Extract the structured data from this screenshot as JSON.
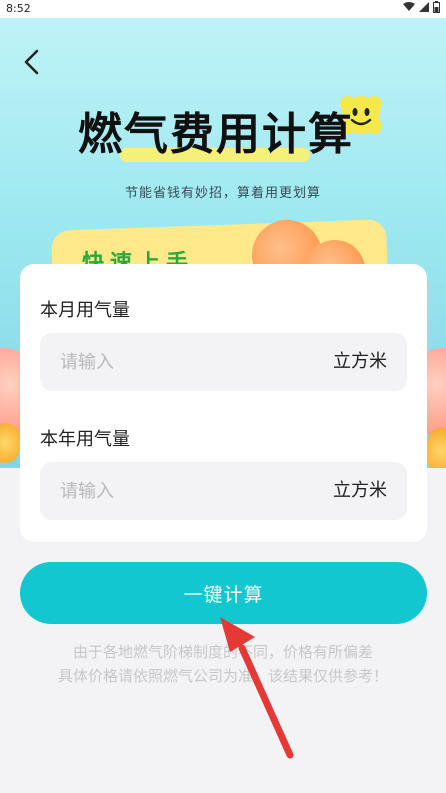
{
  "status_bar": {
    "time": "8:52",
    "icons": [
      "wifi-icon",
      "signal-icon",
      "battery-icon"
    ]
  },
  "header": {
    "back_icon": "chevron-left-icon",
    "title": "燃气费用计算",
    "subtitle": "节能省钱有妙招，算着用更划算",
    "promo_text": "快速上手"
  },
  "form": {
    "monthly": {
      "label": "本月用气量",
      "placeholder": "请输入",
      "value": "",
      "unit": "立方米"
    },
    "yearly": {
      "label": "本年用气量",
      "placeholder": "请输入",
      "value": "",
      "unit": "立方米"
    }
  },
  "action": {
    "calculate_label": "一键计算"
  },
  "notice": {
    "line1": "由于各地燃气阶梯制度的不同，价格有所偏差",
    "line2": "具体价格请依照燃气公司为准，该结果仅供参考！"
  },
  "colors": {
    "accent": "#12c7d0",
    "hero_top": "#bff3f6",
    "annotation_arrow": "#e53935"
  }
}
